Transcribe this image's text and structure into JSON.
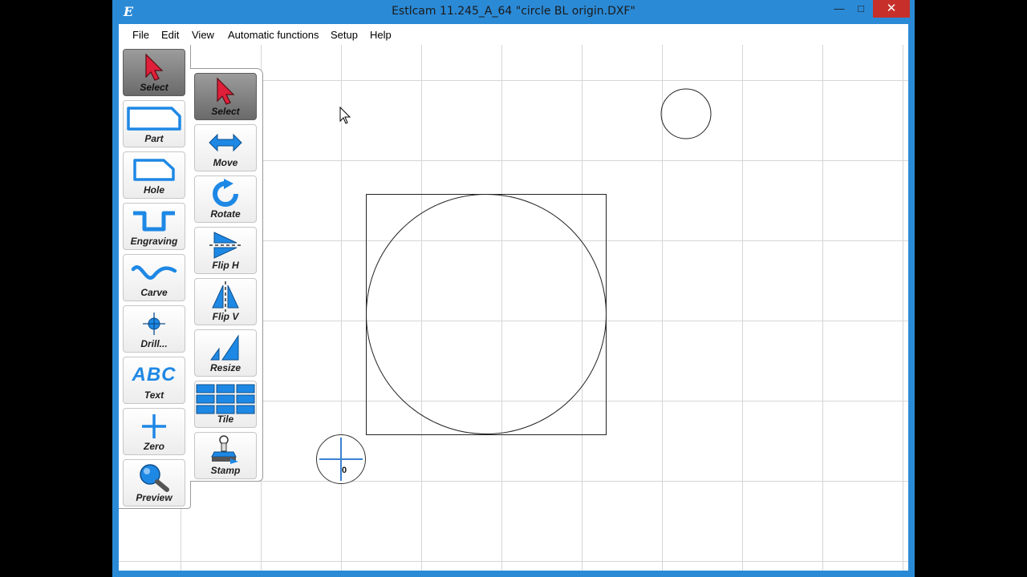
{
  "window": {
    "title": "Estlcam 11.245_A_64 \"circle BL origin.DXF\""
  },
  "menu": [
    "File",
    "Edit",
    "View",
    "Automatic functions",
    "Setup",
    "Help"
  ],
  "toolbar_left": [
    {
      "label": "Select",
      "icon": "select-arrow-icon",
      "active": true
    },
    {
      "label": "Part",
      "icon": "part-icon"
    },
    {
      "label": "Hole",
      "icon": "hole-icon"
    },
    {
      "label": "Engraving",
      "icon": "engraving-icon"
    },
    {
      "label": "Carve",
      "icon": "carve-icon"
    },
    {
      "label": "Drill...",
      "icon": "drill-icon"
    },
    {
      "label": "Text",
      "icon": "text-icon",
      "icon_text": "ABC"
    },
    {
      "label": "Zero",
      "icon": "zero-icon"
    },
    {
      "label": "Preview",
      "icon": "magnifier-icon"
    }
  ],
  "toolbar_right": [
    {
      "label": "Select",
      "icon": "select-arrow-icon",
      "active": true
    },
    {
      "label": "Move",
      "icon": "move-arrows-icon"
    },
    {
      "label": "Rotate",
      "icon": "rotate-icon"
    },
    {
      "label": "Flip H",
      "icon": "flip-horizontal-icon"
    },
    {
      "label": "Flip V",
      "icon": "flip-vertical-icon"
    },
    {
      "label": "Resize",
      "icon": "resize-icon"
    },
    {
      "label": "Tile",
      "icon": "tile-grid-icon"
    },
    {
      "label": "Stamp",
      "icon": "stamp-icon"
    }
  ],
  "canvas": {
    "origin_label": "0"
  },
  "colors": {
    "titlebar": "#2b8ad6",
    "close": "#c7302a",
    "icon_blue": "#1e88e5",
    "arrow_red": "#e0203a"
  }
}
